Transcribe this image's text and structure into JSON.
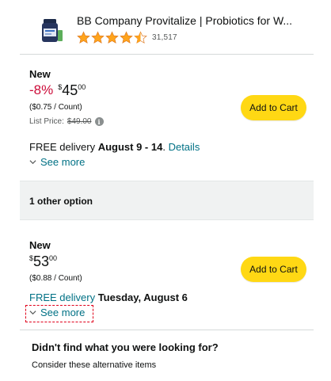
{
  "product": {
    "title": "BB Company Provitalize | Probiotics for W...",
    "rating_stars": 4.5,
    "rating_count": "31,517"
  },
  "offers": [
    {
      "condition": "New",
      "discount": "-8%",
      "currency": "$",
      "price_whole": "45",
      "price_fraction": "00",
      "per_unit": "($0.75 / Count)",
      "list_price_label": "List Price:",
      "list_price": "$49.00",
      "cart_label": "Add to Cart",
      "delivery_prefix": "FREE delivery",
      "delivery_date": "August 9 - 14",
      "delivery_sep": ".",
      "details_label": "Details",
      "see_more": "See more"
    },
    {
      "condition": "New",
      "currency": "$",
      "price_whole": "53",
      "price_fraction": "00",
      "per_unit": "($0.88 / Count)",
      "cart_label": "Add to Cart",
      "delivery_prefix": "FREE delivery",
      "delivery_date": "Tuesday, August 6",
      "see_more": "See more"
    }
  ],
  "other_options": {
    "label": "1 other option"
  },
  "alternatives": {
    "title": "Didn't find what you were looking for?",
    "subtitle": "Consider these alternative items"
  },
  "colors": {
    "accent_button": "#FFD814",
    "discount": "#CC0C39",
    "link": "#007185",
    "star": "#FFA41C",
    "highlight_box": "#E0001B"
  },
  "icons": [
    "product-thumbnail",
    "star-icon",
    "info-icon",
    "chevron-down-icon"
  ]
}
